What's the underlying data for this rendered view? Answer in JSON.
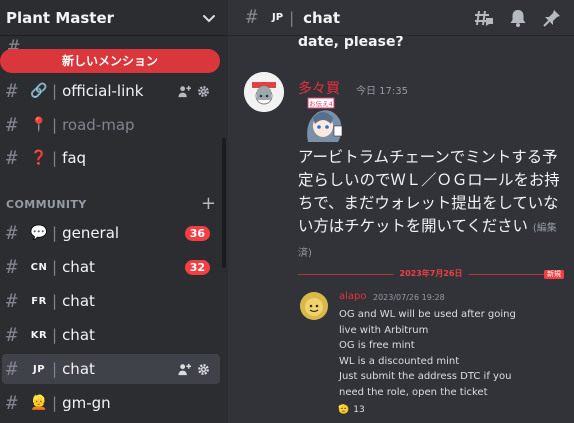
{
  "server": {
    "name": "Plant Master"
  },
  "mention_pill": "新しいメンション",
  "sidebar": {
    "category": "COMMUNITY",
    "channels": [
      {
        "emoji": "🔗",
        "name": "official-link"
      },
      {
        "emoji": "📍",
        "name": "road-map"
      },
      {
        "emoji": "❓",
        "name": "faq"
      },
      {
        "emoji": "💬",
        "name": "general",
        "badge": "36"
      },
      {
        "code": "CN",
        "name": "chat",
        "badge": "32"
      },
      {
        "code": "FR",
        "name": "chat"
      },
      {
        "code": "KR",
        "name": "chat"
      },
      {
        "code": "JP",
        "name": "chat"
      },
      {
        "emoji": "👱",
        "name": "gm-gn"
      }
    ]
  },
  "channel_header": {
    "code": "JP",
    "name": "chat"
  },
  "messages": {
    "previous_text": "date, please?",
    "main": {
      "author": "多々買",
      "author_color": "#e8313a",
      "time": "今日 17:35",
      "sticker_text": "お伝え4",
      "text": "アービトラムチェーンでミントする予定らしいのでＷＬ／ＯＧロールをお持ちで、まだウォレット提出をしていない方はチケットを開いてください",
      "edited": "(編集済)"
    },
    "divider": {
      "date": "2023年7月26日",
      "new_label": "新規"
    },
    "reply": {
      "author": "alapo",
      "author_color": "#e8313a",
      "time": "2023/07/26 19:28",
      "lines": [
        "OG and WL will be used after going",
        "live with Arbitrum",
        "OG is free mint",
        "WL is a discounted mint",
        "Just submit the address DTC  if you",
        "need the role, open the ticket"
      ],
      "reaction_emoji": "🫡",
      "reaction_count": "13"
    }
  }
}
